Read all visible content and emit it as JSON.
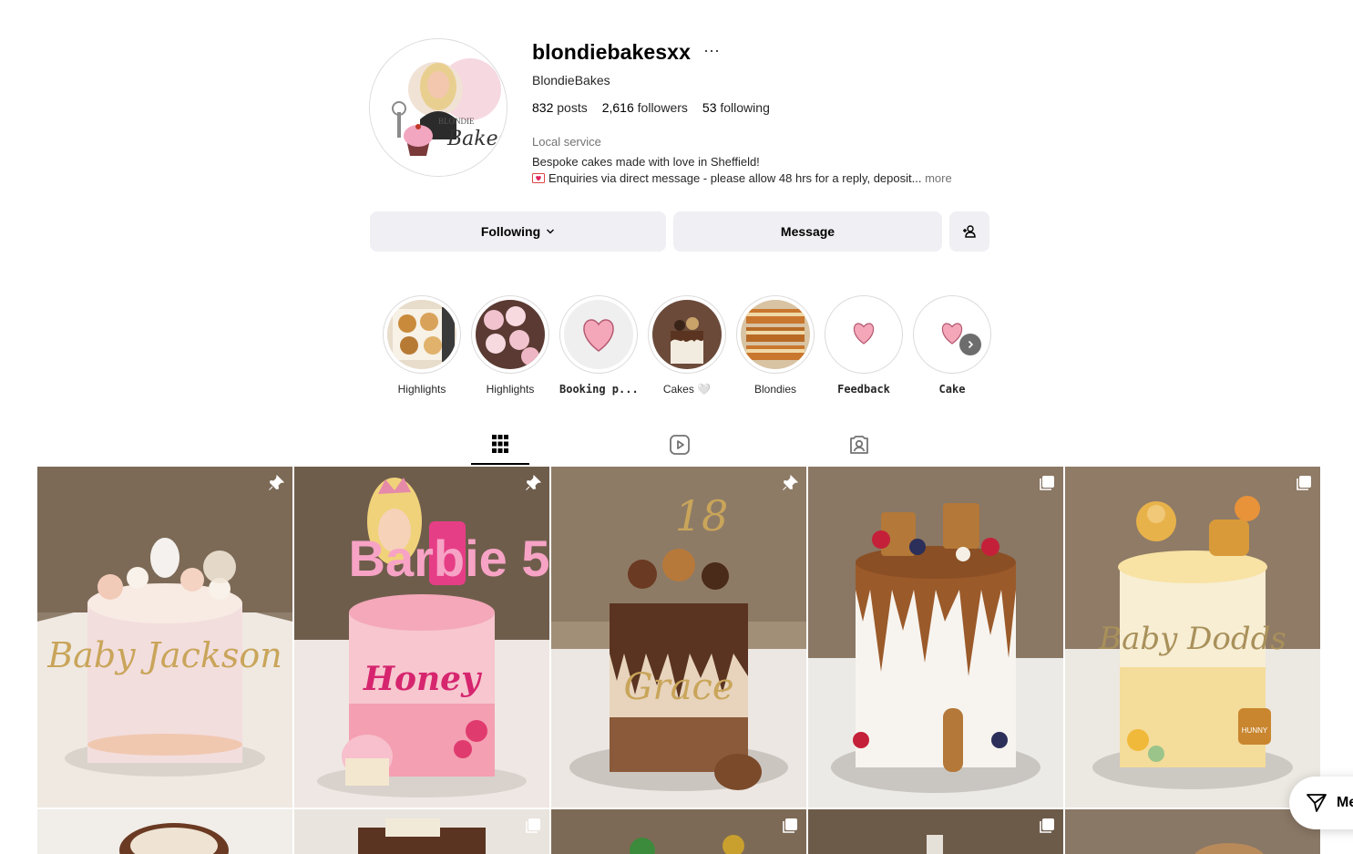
{
  "profile": {
    "username": "blondiebakesxx",
    "full_name": "BlondieBakes",
    "avatar_icon": "blondie-bakes-logo",
    "stats": {
      "posts_count": "832",
      "posts_label": "posts",
      "followers_count": "2,616",
      "followers_label": "followers",
      "following_count": "53",
      "following_label": "following"
    },
    "category": "Local service",
    "bio_line1": "Bespoke cakes made with love in Sheffield!",
    "bio_line2": "Enquiries via direct message - please allow 48 hrs for a reply, deposit...",
    "bio_more": "more"
  },
  "actions": {
    "following_label": "Following",
    "message_label": "Message",
    "add_user_icon": "add-user-icon"
  },
  "highlights": [
    {
      "label": "Highlights",
      "icon": "cupcakes-box"
    },
    {
      "label": "Highlights",
      "icon": "pink-cupcakes"
    },
    {
      "label": "Booking p...",
      "icon": "heart"
    },
    {
      "label": "Cakes 🤍",
      "icon": "chocolate-cake"
    },
    {
      "label": "Blondies",
      "icon": "blondie-slices"
    },
    {
      "label": "Feedback",
      "icon": "heart"
    },
    {
      "label": "Cake",
      "icon": "heart"
    }
  ],
  "tabs": [
    {
      "name": "posts",
      "icon": "grid-icon",
      "active": true
    },
    {
      "name": "reels",
      "icon": "reels-icon",
      "active": false
    },
    {
      "name": "tagged",
      "icon": "tagged-icon",
      "active": false
    }
  ],
  "posts": [
    {
      "text": "Baby Jackson",
      "badge": "pin-icon"
    },
    {
      "text": "Honey",
      "extra": "Barbie 5",
      "badge": "pin-icon"
    },
    {
      "text": "Grace",
      "extra": "18",
      "badge": "pin-icon"
    },
    {
      "text": "",
      "badge": "carousel-icon"
    },
    {
      "text": "Baby Dodds",
      "extra": "HUNNY",
      "badge": "carousel-icon"
    }
  ],
  "floating": {
    "messages_label": "Me"
  },
  "colors": {
    "button_bg": "#efeff4",
    "muted": "#737373",
    "heart": "#f4a7b9"
  }
}
